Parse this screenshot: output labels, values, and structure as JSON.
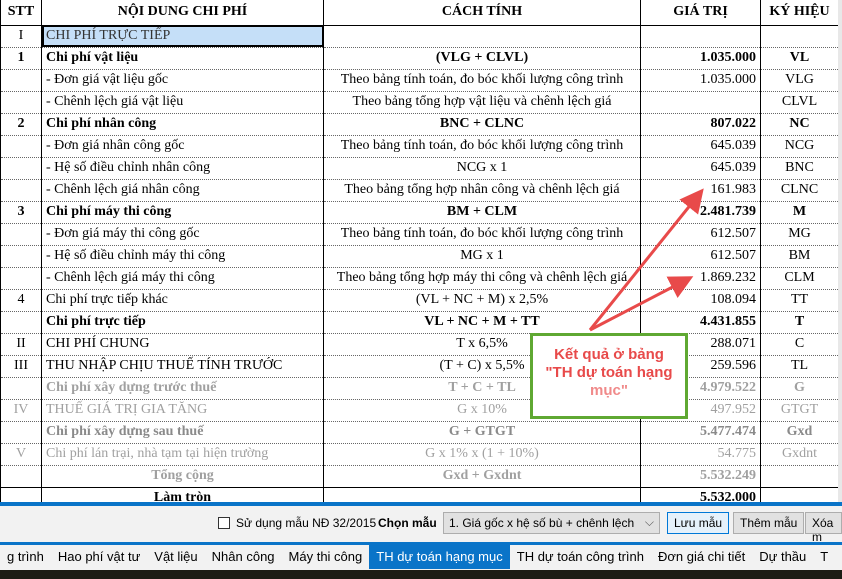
{
  "table": {
    "headers": [
      "STT",
      "NỘI DUNG CHI PHÍ",
      "CÁCH TÍNH",
      "GIÁ TRỊ",
      "KÝ HIỆU"
    ],
    "rows": [
      {
        "stt": "I",
        "content": "CHI PHÍ TRỰC TIẾP",
        "formula": "",
        "value": "",
        "symbol": "",
        "style": "sel"
      },
      {
        "stt": "1",
        "content": "Chi phí vật liệu",
        "formula": "(VLG + CLVL)",
        "value": "1.035.000",
        "symbol": "VL",
        "style": "b"
      },
      {
        "stt": "",
        "content": "- Đơn giá vật liệu gốc",
        "formula": "Theo bảng tính toán, đo bóc khối lượng công trình",
        "value": "1.035.000",
        "symbol": "VLG",
        "style": ""
      },
      {
        "stt": "",
        "content": "- Chênh lệch giá vật liệu",
        "formula": "Theo bảng tổng hợp vật liệu và chênh lệch giá",
        "value": "",
        "symbol": "CLVL",
        "style": ""
      },
      {
        "stt": "2",
        "content": "Chi phí nhân công",
        "formula": "BNC + CLNC",
        "value": "807.022",
        "symbol": "NC",
        "style": "b"
      },
      {
        "stt": "",
        "content": "- Đơn giá nhân công gốc",
        "formula": "Theo bảng tính toán, đo bóc khối lượng công trình",
        "value": "645.039",
        "symbol": "NCG",
        "style": ""
      },
      {
        "stt": "",
        "content": "- Hệ số điều chỉnh nhân công",
        "formula": "NCG x 1",
        "value": "645.039",
        "symbol": "BNC",
        "style": ""
      },
      {
        "stt": "",
        "content": "- Chênh lệch giá nhân công",
        "formula": "Theo bảng tổng hợp nhân công và chênh lệch giá",
        "value": "161.983",
        "symbol": "CLNC",
        "style": ""
      },
      {
        "stt": "3",
        "content": "Chi phí máy thi công",
        "formula": "BM + CLM",
        "value": "2.481.739",
        "symbol": "M",
        "style": "b"
      },
      {
        "stt": "",
        "content": "- Đơn giá máy thi công gốc",
        "formula": "Theo bảng tính toán, đo bóc khối lượng công trình",
        "value": "612.507",
        "symbol": "MG",
        "style": ""
      },
      {
        "stt": "",
        "content": "- Hệ số điều chỉnh máy thi công",
        "formula": "MG x 1",
        "value": "612.507",
        "symbol": "BM",
        "style": ""
      },
      {
        "stt": "",
        "content": "- Chênh lệch giá máy thi công",
        "formula": "Theo bảng tổng hợp máy thi công và chênh lệch giá",
        "value": "1.869.232",
        "symbol": "CLM",
        "style": ""
      },
      {
        "stt": "4",
        "content": "Chi phí trực tiếp khác",
        "formula": "(VL + NC + M) x 2,5%",
        "value": "108.094",
        "symbol": "TT",
        "style": ""
      },
      {
        "stt": "",
        "content": "Chi phí trực tiếp",
        "formula": "VL + NC + M + TT",
        "value": "4.431.855",
        "symbol": "T",
        "style": "b"
      },
      {
        "stt": "II",
        "content": "CHI PHÍ CHUNG",
        "formula": "T x 6,5%",
        "value": "288.071",
        "symbol": "C",
        "style": ""
      },
      {
        "stt": "III",
        "content": "THU NHẬP CHỊU THUẾ TÍNH TRƯỚC",
        "formula": "(T + C) x 5,5%",
        "value": "259.596",
        "symbol": "TL",
        "style": ""
      },
      {
        "stt": "",
        "content": "Chi phí xây dựng trước thuế",
        "formula": "T + C + TL",
        "value": "4.979.522",
        "symbol": "G",
        "style": "g b"
      },
      {
        "stt": "IV",
        "content": "THUẾ GIÁ TRỊ GIA TĂNG",
        "formula": "G x 10%",
        "value": "497.952",
        "symbol": "GTGT",
        "style": "g"
      },
      {
        "stt": "",
        "content": "Chi phí xây dựng sau thuế",
        "formula": "G + GTGT",
        "value": "5.477.474",
        "symbol": "Gxd",
        "style": "gb"
      },
      {
        "stt": "V",
        "content": "Chi phí lán trại, nhà tạm tại hiện trường",
        "formula": "G x 1% x (1 + 10%)",
        "value": "54.775",
        "symbol": "Gxdnt",
        "style": "g"
      },
      {
        "stt": "",
        "content": "Tổng cộng",
        "formula": "Gxd + Gxdnt",
        "value": "5.532.249",
        "symbol": "",
        "style": "g b center"
      },
      {
        "stt": "",
        "content": "Làm tròn",
        "formula": "",
        "value": "5.532.000",
        "symbol": "",
        "style": "b center last"
      }
    ]
  },
  "callout": {
    "line1": "Kết quả ở bảng",
    "line2": "\"TH dự toán hạng",
    "line3": "mục\"",
    "border_color": "#5fa832",
    "text_color": "#e84a4a",
    "arrow_color": "#e84a4a"
  },
  "toolbar": {
    "checkbox_label": "Sử dụng mẫu NĐ 32/2015",
    "checkbox_checked": false,
    "chon_mau_label": "Chọn mẫu",
    "template_selected": "1. Giá gốc x hệ số bù + chênh lệch",
    "save_button": "Lưu mẫu",
    "add_button": "Thêm mẫu",
    "delete_button": "Xóa m"
  },
  "tabs": [
    "g trình",
    "Hao phí vật tư",
    "Vật liệu",
    "Nhân công",
    "Máy thi công",
    "TH dự toán hạng mục",
    "TH dự toán công trình",
    "Đơn giá chi tiết",
    "Dự thầu",
    "T"
  ],
  "active_tab": "TH dự toán hạng mục",
  "accent_color": "#0a74c8"
}
